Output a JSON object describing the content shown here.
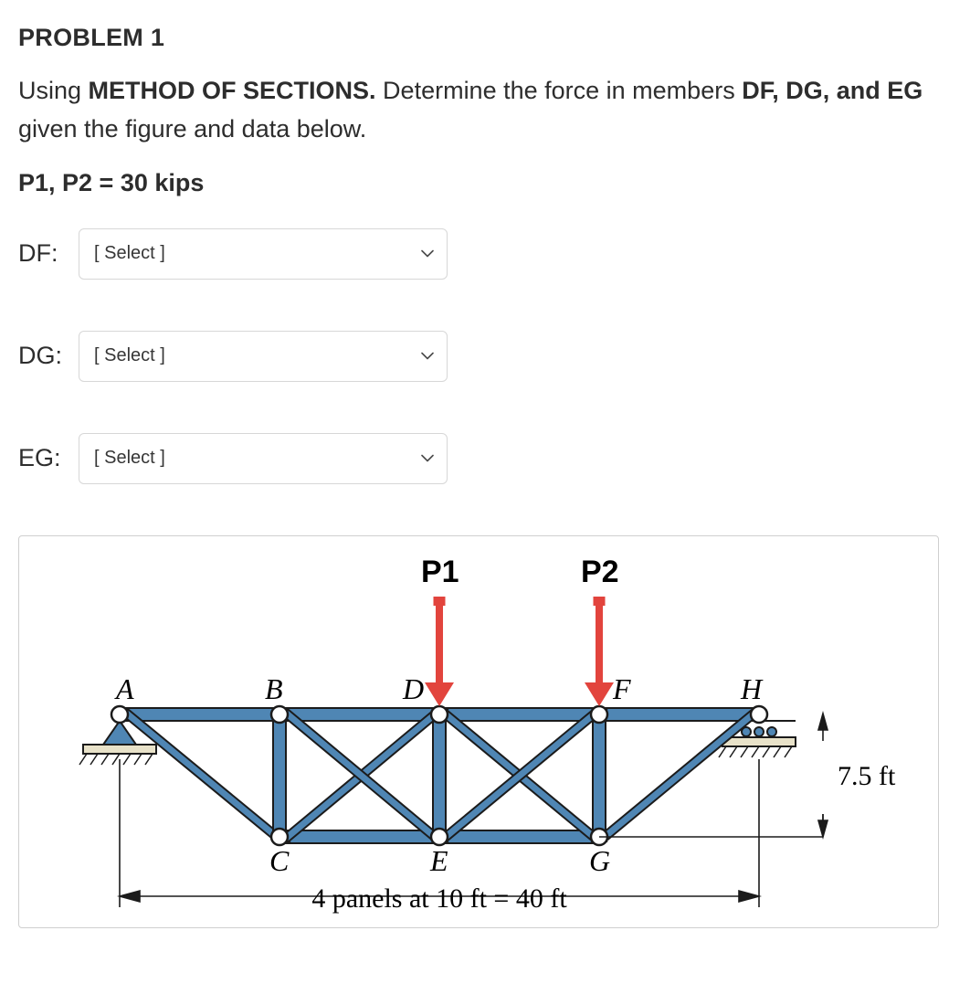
{
  "problem": {
    "title": "PROBLEM 1",
    "prompt_prefix": "Using ",
    "method": "METHOD OF SECTIONS.",
    "prompt_mid": " Determine the force in members ",
    "members": "DF, DG, and EG",
    "prompt_end": " given the figure and data below.",
    "given": "P1, P2 = 30 kips"
  },
  "answers": [
    {
      "label": "DF:",
      "placeholder": "[ Select ]"
    },
    {
      "label": "DG:",
      "placeholder": "[ Select ]"
    },
    {
      "label": "EG:",
      "placeholder": "[ Select ]"
    }
  ],
  "figure": {
    "loads": {
      "P1": "P1",
      "P2": "P2"
    },
    "nodes": {
      "A": "A",
      "B": "B",
      "C": "C",
      "D": "D",
      "E": "E",
      "F": "F",
      "G": "G",
      "H": "H"
    },
    "height_label": "7.5 ft",
    "span_label": "4 panels at 10 ft = 40 ft"
  },
  "chart_data": {
    "type": "diagram",
    "description": "Pratt-type truss with top chord A-B-D-F-H and bottom chord C-E-G, pin support at A, roller at H.",
    "panel_length_ft": 10,
    "num_panels": 4,
    "total_span_ft": 40,
    "depth_ft": 7.5,
    "top_nodes_x_ft": {
      "A": 0,
      "B": 10,
      "D": 20,
      "F": 30,
      "H": 40
    },
    "bottom_nodes_x_ft": {
      "C": 10,
      "E": 20,
      "G": 30
    },
    "loads": [
      {
        "name": "P1",
        "node": "D",
        "direction": "down",
        "magnitude_kips": 30
      },
      {
        "name": "P2",
        "node": "F",
        "direction": "down",
        "magnitude_kips": 30
      }
    ],
    "supports": {
      "A": "pin",
      "H": "roller"
    },
    "members_requested": [
      "DF",
      "DG",
      "EG"
    ]
  }
}
